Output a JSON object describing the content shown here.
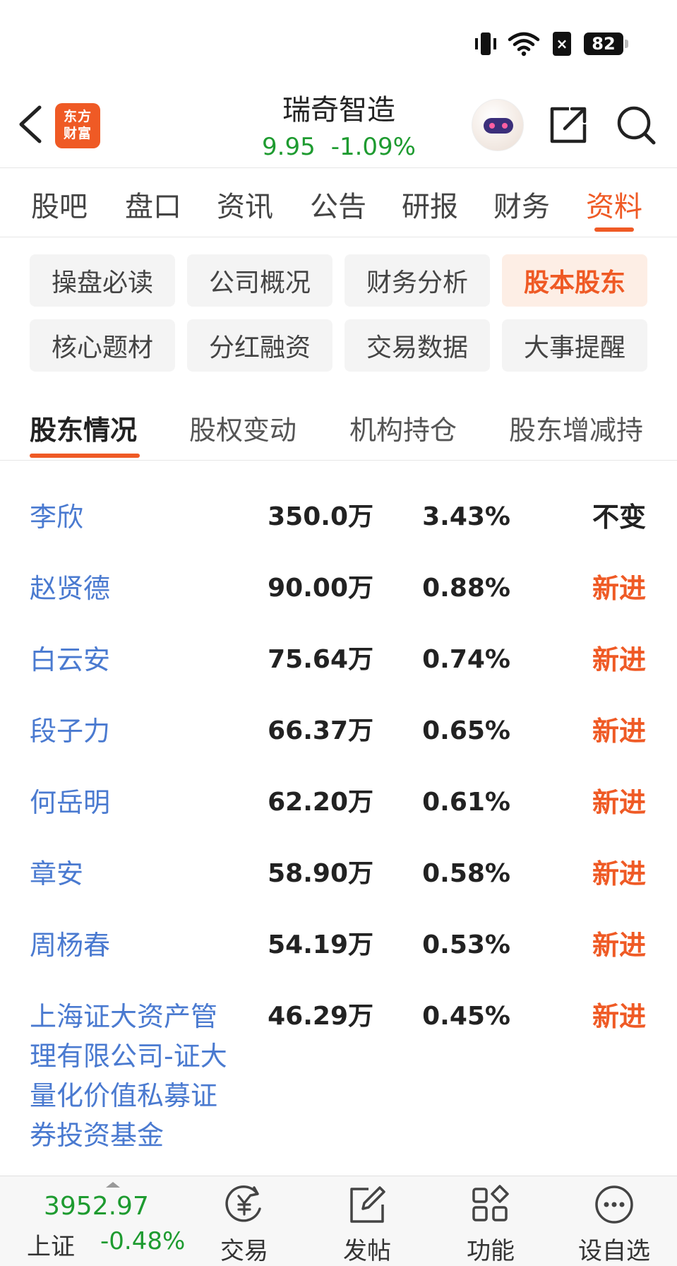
{
  "status_bar": {
    "battery": "82",
    "sim_badge": "×"
  },
  "header": {
    "logo_text": "东方\n财富",
    "stock_name": "瑞奇智造",
    "price": "9.95",
    "change_pct": "-1.09%"
  },
  "main_tabs": [
    {
      "label": "股吧"
    },
    {
      "label": "盘口"
    },
    {
      "label": "资讯"
    },
    {
      "label": "公告"
    },
    {
      "label": "研报"
    },
    {
      "label": "财务"
    },
    {
      "label": "资料",
      "active": true
    }
  ],
  "chips": [
    {
      "label": "操盘必读"
    },
    {
      "label": "公司概况"
    },
    {
      "label": "财务分析"
    },
    {
      "label": "股本股东",
      "active": true
    },
    {
      "label": "核心题材"
    },
    {
      "label": "分红融资"
    },
    {
      "label": "交易数据"
    },
    {
      "label": "大事提醒"
    }
  ],
  "sub_tabs": [
    {
      "label": "股东情况",
      "active": true
    },
    {
      "label": "股权变动"
    },
    {
      "label": "机构持仓"
    },
    {
      "label": "股东增减持"
    }
  ],
  "holders": [
    {
      "name": "李欣",
      "shares": "350.0万",
      "pct": "3.43%",
      "change": "不变"
    },
    {
      "name": "赵贤德",
      "shares": "90.00万",
      "pct": "0.88%",
      "change": "新进"
    },
    {
      "name": "白云安",
      "shares": "75.64万",
      "pct": "0.74%",
      "change": "新进"
    },
    {
      "name": "段子力",
      "shares": "66.37万",
      "pct": "0.65%",
      "change": "新进"
    },
    {
      "name": "何岳明",
      "shares": "62.20万",
      "pct": "0.61%",
      "change": "新进"
    },
    {
      "name": "章安",
      "shares": "58.90万",
      "pct": "0.58%",
      "change": "新进"
    },
    {
      "name": "周杨春",
      "shares": "54.19万",
      "pct": "0.53%",
      "change": "新进"
    },
    {
      "name": "上海证大资产管理有限公司-证大量化价值私募证券投资基金",
      "shares": "46.29万",
      "pct": "0.45%",
      "change": "新进"
    }
  ],
  "bottom_bar": {
    "index_value": "3952.97",
    "index_name": "上证",
    "index_change": "-0.48%",
    "nav": [
      {
        "label": "交易",
        "icon": "yuan-exchange-icon"
      },
      {
        "label": "发帖",
        "icon": "edit-post-icon"
      },
      {
        "label": "功能",
        "icon": "grid-apps-icon"
      },
      {
        "label": "设自选",
        "icon": "more-dots-icon"
      }
    ]
  },
  "colors": {
    "accent": "#ef5a25",
    "down_green": "#1e9b30",
    "holder_name_blue": "#4a7ad0",
    "chip_bg": "#f4f4f4",
    "chip_active_bg": "#fdeee5"
  }
}
